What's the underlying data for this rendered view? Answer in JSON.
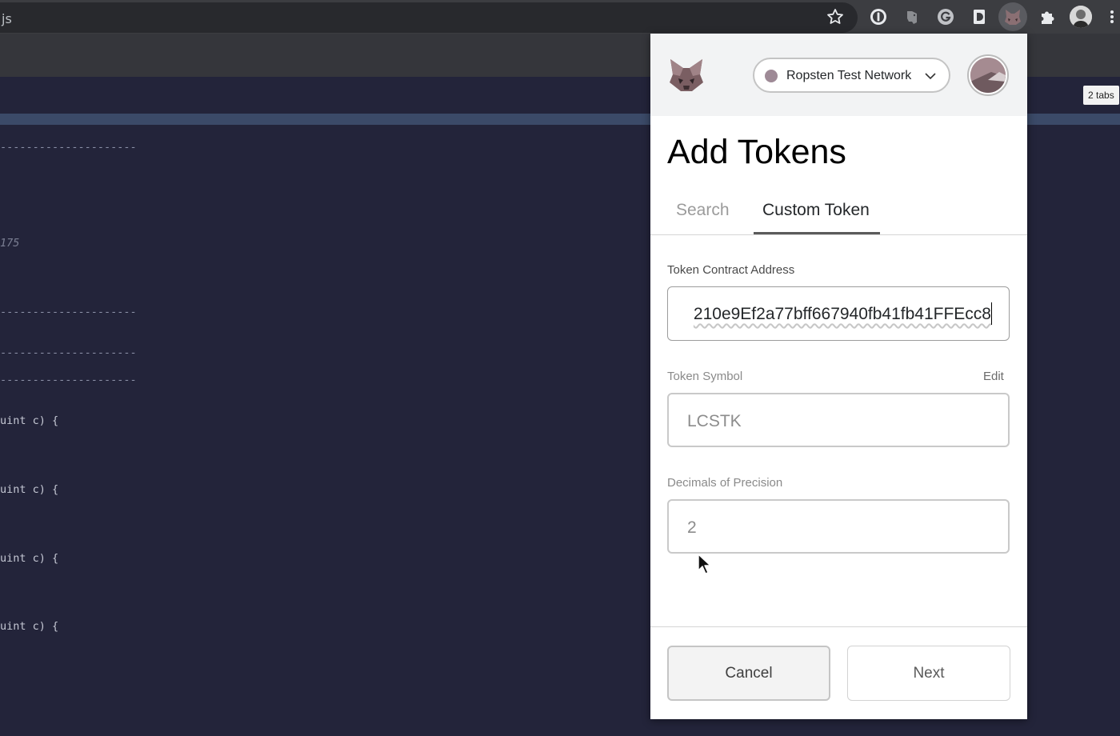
{
  "browser": {
    "address_fragment": "js",
    "tabs_badge": "2 tabs"
  },
  "editor": {
    "lines": [
      "---------------------",
      "175",
      "---------------------",
      "---------------------",
      "---------------------",
      "uint c) {",
      "uint c) {",
      "uint c) {",
      "uint c) {"
    ]
  },
  "metamask": {
    "network": "Ropsten Test Network",
    "title": "Add Tokens",
    "tabs": [
      {
        "label": "Search",
        "active": false
      },
      {
        "label": "Custom Token",
        "active": true
      }
    ],
    "contract_address": {
      "label": "Token Contract Address",
      "value": "210e9Ef2a77bff667940fb41fb41FFEcc8"
    },
    "token_symbol": {
      "label": "Token Symbol",
      "edit_label": "Edit",
      "value": "LCSTK"
    },
    "decimals": {
      "label": "Decimals of Precision",
      "value": "2"
    },
    "buttons": {
      "cancel": "Cancel",
      "next": "Next"
    }
  },
  "icons": {
    "star": "bookmark-star-icon",
    "extensions": [
      "1password-icon",
      "evernote-icon",
      "grammarly-icon",
      "d-extension-icon",
      "metamask-icon",
      "puzzle-extensions-icon"
    ],
    "network_dropdown": "chevron-down-icon",
    "pointer": "mouse-pointer-icon"
  },
  "colors": {
    "editor_bg": "#23243a",
    "popup_header_bg": "#f2f3f4",
    "network_dot": "#9e8a96"
  }
}
